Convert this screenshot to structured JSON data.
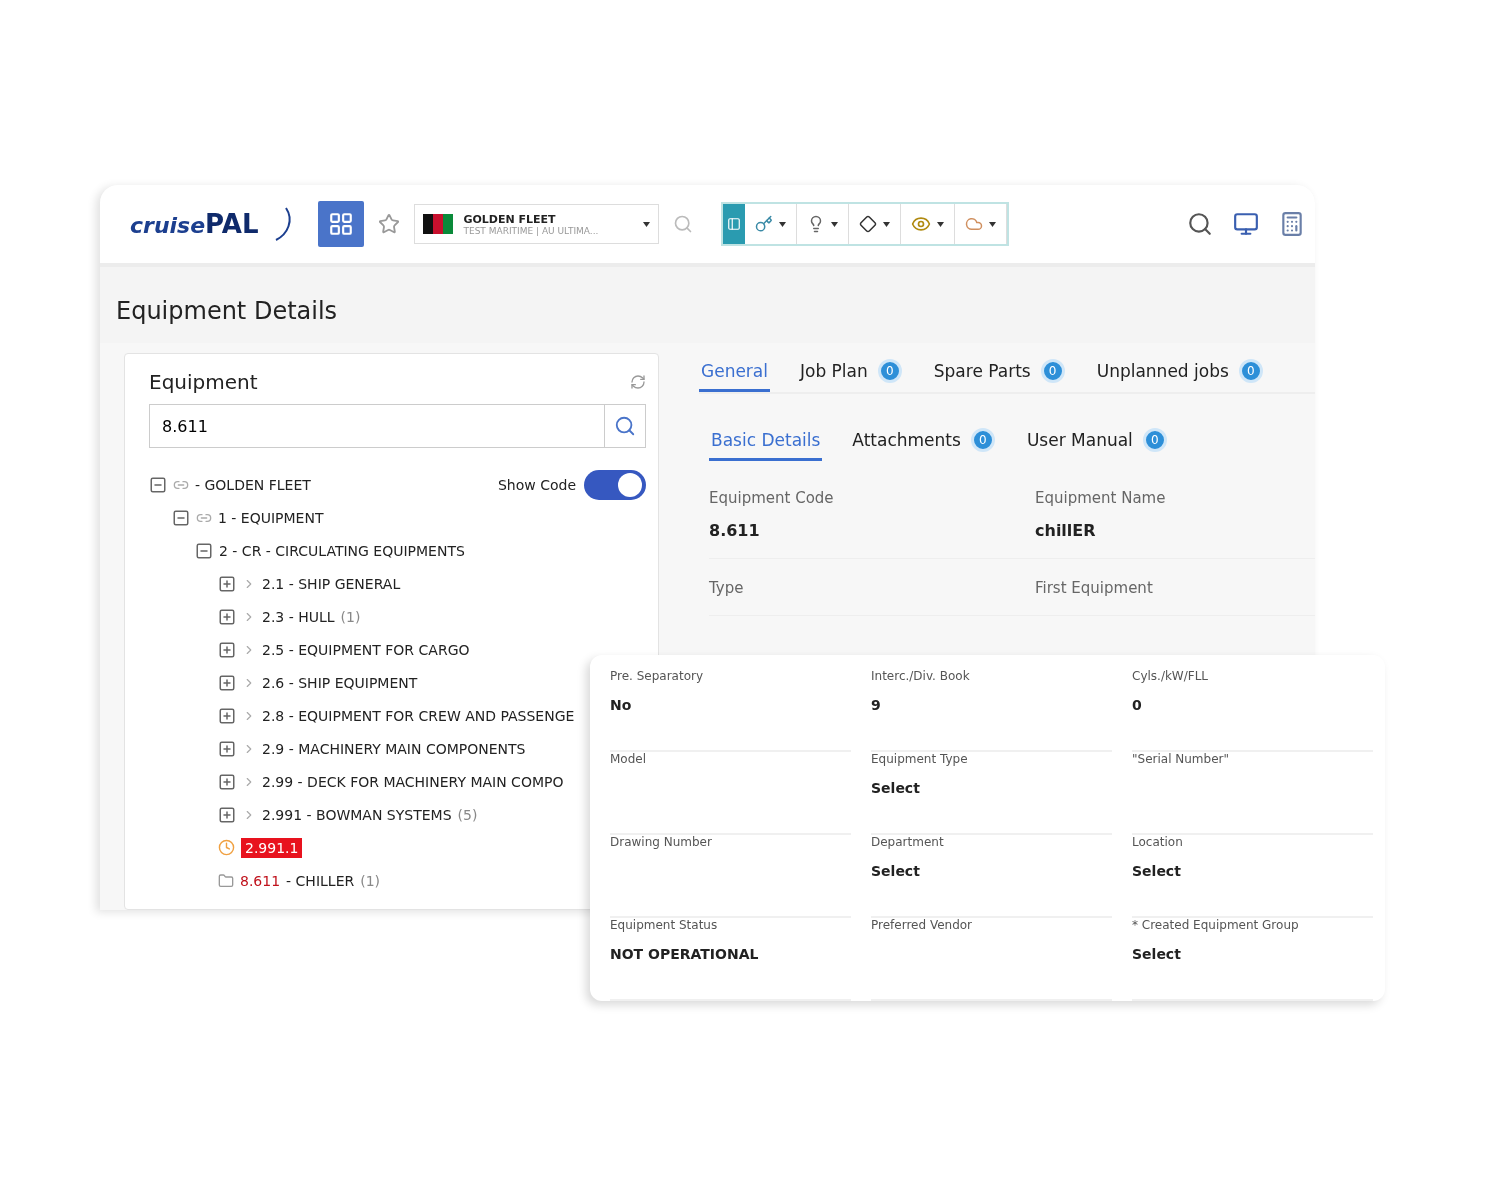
{
  "header": {
    "logo": {
      "first": "cruise",
      "second": "PAL"
    },
    "fleet": {
      "name": "GOLDEN FLEET",
      "subtitle": "TEST MARITIME  |  AU ULTIMA..."
    }
  },
  "page_title": "Equipment Details",
  "equipment_panel": {
    "title": "Equipment",
    "search_value": "8.611",
    "show_code": {
      "label": "Show Code",
      "on": true
    },
    "tree": [
      {
        "kind": "root",
        "label": "- GOLDEN FLEET",
        "expanded": true,
        "children": [
          {
            "kind": "root",
            "label": "1 - EQUIPMENT",
            "expanded": true,
            "children": [
              {
                "kind": "group",
                "label": "2 - CR - CIRCULATING EQUIPMENTS",
                "expanded": true,
                "children": [
                  {
                    "kind": "item",
                    "label": "2.1 - SHIP GENERAL",
                    "expanded": false
                  },
                  {
                    "kind": "item",
                    "label": "2.3 - HULL",
                    "count": "(1)",
                    "expanded": false
                  },
                  {
                    "kind": "item",
                    "label": "2.5 - EQUIPMENT FOR CARGO",
                    "expanded": false
                  },
                  {
                    "kind": "item",
                    "label": "2.6 - SHIP EQUIPMENT",
                    "expanded": false
                  },
                  {
                    "kind": "item",
                    "label": "2.8 - EQUIPMENT FOR CREW AND PASSENGE",
                    "expanded": false
                  },
                  {
                    "kind": "item",
                    "label": "2.9 - MACHINERY MAIN COMPONENTS",
                    "expanded": false
                  },
                  {
                    "kind": "item",
                    "label": "2.99 - DECK FOR MACHINERY MAIN COMPO",
                    "expanded": false
                  },
                  {
                    "kind": "item",
                    "label": "2.991 - BOWMAN SYSTEMS",
                    "count": "(5)",
                    "expanded": false
                  },
                  {
                    "kind": "current",
                    "label": "2.991.1"
                  },
                  {
                    "kind": "equipment",
                    "code": "8.611",
                    "label": "- CHILLER",
                    "count": "(1)"
                  }
                ]
              }
            ]
          }
        ]
      }
    ]
  },
  "tabs": [
    {
      "label": "General",
      "selected": true
    },
    {
      "label": "Job Plan",
      "badge": "0",
      "selected": false
    },
    {
      "label": "Spare Parts",
      "badge": "0",
      "selected": false
    },
    {
      "label": "Unplanned jobs",
      "badge": "0",
      "selected": false
    }
  ],
  "subtabs": [
    {
      "label": "Basic Details",
      "selected": true
    },
    {
      "label": "Attachments",
      "badge": "0",
      "selected": false
    },
    {
      "label": "User Manual",
      "badge": "0",
      "selected": false
    }
  ],
  "fields": [
    {
      "label": "Equipment Code",
      "value": "8.611"
    },
    {
      "label": "Equipment Name",
      "value": "chillER"
    },
    {
      "label": "Type"
    },
    {
      "label": "First Equipment"
    }
  ],
  "detail_card": {
    "fields": [
      {
        "label": "Pre. Separatory",
        "value": "No"
      },
      {
        "label": "Interc./Div. Book",
        "value": "9"
      },
      {
        "label": "Cyls./kW/FLL",
        "value": "0"
      },
      {
        "label": "Model"
      },
      {
        "label": "Equipment Type",
        "value": "Select"
      },
      {
        "label": "\"Serial Number\""
      },
      {
        "label": "Drawing Number"
      },
      {
        "label": "Department",
        "value": "Select"
      },
      {
        "label": "Location",
        "value": "Select"
      },
      {
        "label": "Equipment Status",
        "value": "NOT OPERATIONAL"
      },
      {
        "label": "Preferred Vendor"
      },
      {
        "label": "* Created Equipment Group",
        "value": "Select"
      }
    ]
  }
}
